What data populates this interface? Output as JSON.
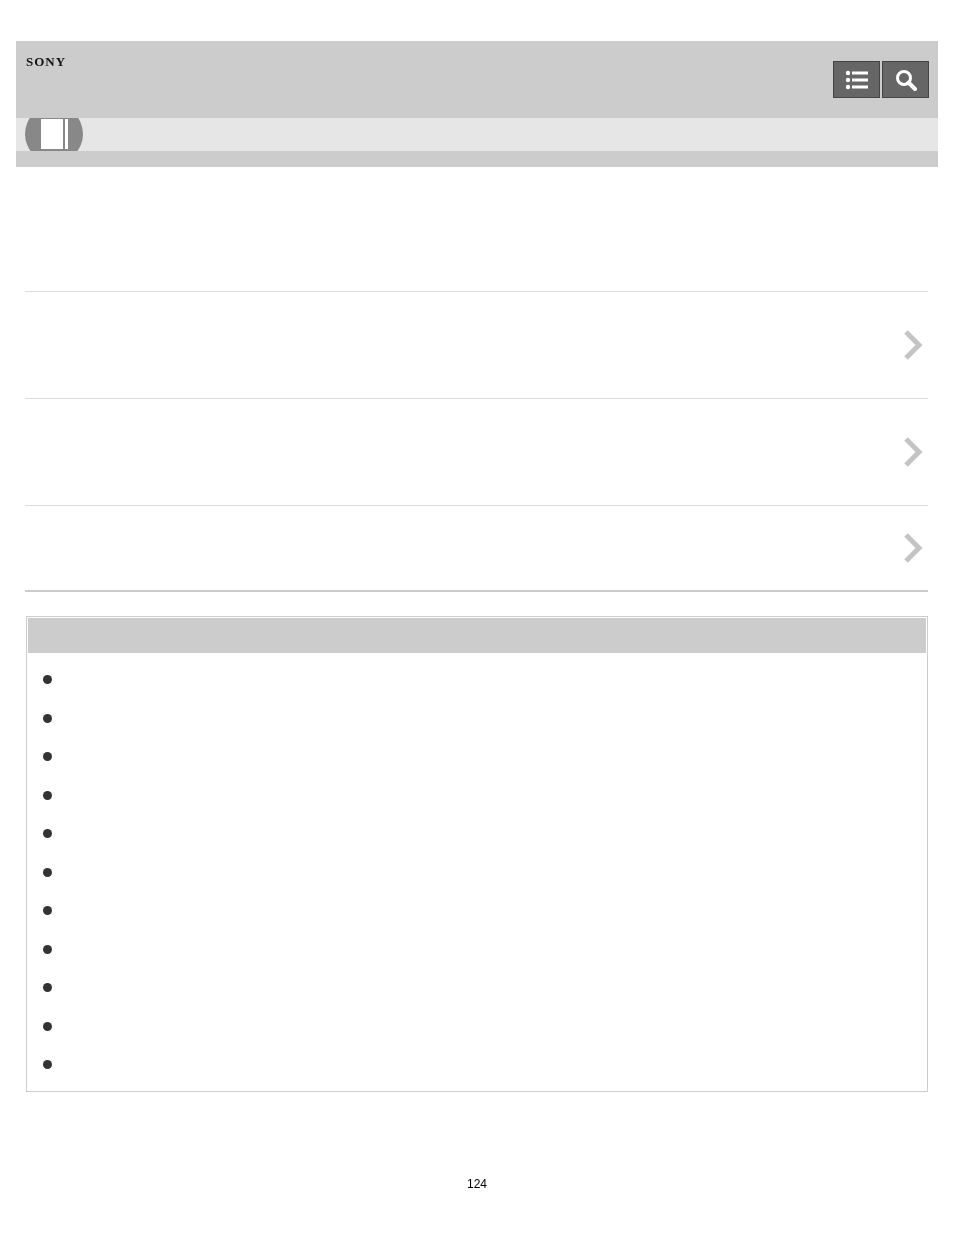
{
  "header": {
    "logo": "SONY",
    "buttons": [
      {
        "kind": "contents"
      },
      {
        "kind": "search"
      }
    ]
  },
  "links": [
    {
      "kind": "link"
    },
    {
      "kind": "link"
    },
    {
      "kind": "link"
    }
  ],
  "related_box": {
    "bullets": [
      {
        "kind": "bullet"
      },
      {
        "kind": "bullet"
      },
      {
        "kind": "bullet"
      },
      {
        "kind": "bullet"
      },
      {
        "kind": "bullet"
      },
      {
        "kind": "bullet"
      },
      {
        "kind": "bullet"
      },
      {
        "kind": "bullet"
      },
      {
        "kind": "bullet"
      },
      {
        "kind": "bullet"
      },
      {
        "kind": "bullet"
      }
    ]
  },
  "page_number": "124"
}
